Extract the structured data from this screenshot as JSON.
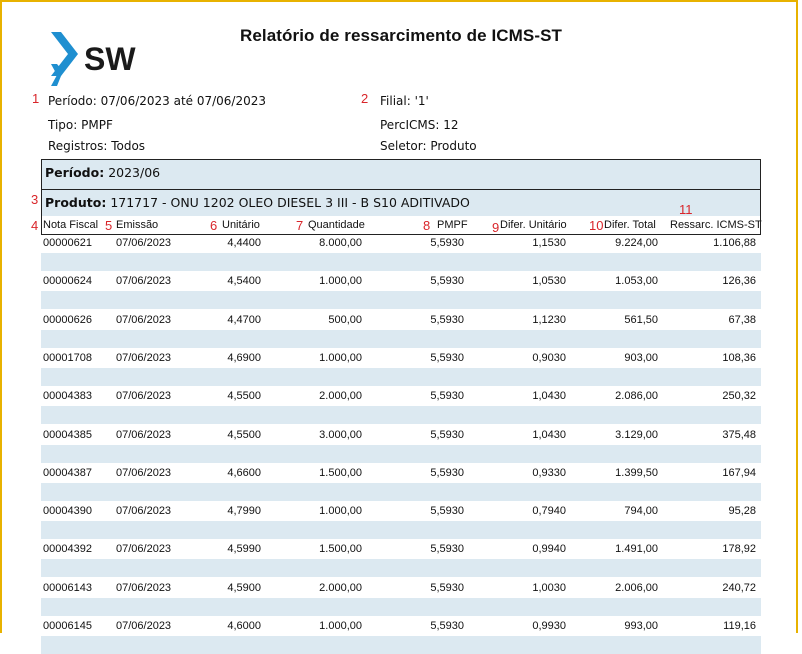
{
  "report": {
    "title": "Relatório de ressarcimento de ICMS-ST",
    "logo_text": "SW",
    "accent_color": "#1f8fd0"
  },
  "meta": {
    "periodo": "Período:  07/06/2023 até 07/06/2023",
    "tipo": "Tipo: PMPF",
    "registros": "Registros: Todos",
    "filial": "Filial: '1'",
    "percicms": "PercICMS: 12",
    "seletor": "Seletor: Produto"
  },
  "annotations": [
    "1",
    "2",
    "3",
    "4",
    "5",
    "6",
    "7",
    "8",
    "9",
    "10",
    "11"
  ],
  "group": {
    "periodo_label": "Período:",
    "periodo_value": "2023/06",
    "produto_label": "Produto:",
    "produto_value": "171717 - ONU 1202 OLEO DIESEL 3 III - B S10 ADITIVADO"
  },
  "columns": [
    "Nota Fiscal",
    "Emissão",
    "Unitário",
    "Quantidade",
    "PMPF",
    "Difer. Unitário",
    "Difer. Total",
    "Ressarc. ICMS-ST"
  ],
  "rows": [
    [
      "00000621",
      "07/06/2023",
      "4,4400",
      "8.000,00",
      "5,5930",
      "1,1530",
      "9.224,00",
      "1.106,88"
    ],
    [
      "00000624",
      "07/06/2023",
      "4,5400",
      "1.000,00",
      "5,5930",
      "1,0530",
      "1.053,00",
      "126,36"
    ],
    [
      "00000626",
      "07/06/2023",
      "4,4700",
      "500,00",
      "5,5930",
      "1,1230",
      "561,50",
      "67,38"
    ],
    [
      "00001708",
      "07/06/2023",
      "4,6900",
      "1.000,00",
      "5,5930",
      "0,9030",
      "903,00",
      "108,36"
    ],
    [
      "00004383",
      "07/06/2023",
      "4,5500",
      "2.000,00",
      "5,5930",
      "1,0430",
      "2.086,00",
      "250,32"
    ],
    [
      "00004385",
      "07/06/2023",
      "4,5500",
      "3.000,00",
      "5,5930",
      "1,0430",
      "3.129,00",
      "375,48"
    ],
    [
      "00004387",
      "07/06/2023",
      "4,6600",
      "1.500,00",
      "5,5930",
      "0,9330",
      "1.399,50",
      "167,94"
    ],
    [
      "00004390",
      "07/06/2023",
      "4,7990",
      "1.000,00",
      "5,5930",
      "0,7940",
      "794,00",
      "95,28"
    ],
    [
      "00004392",
      "07/06/2023",
      "4,5990",
      "1.500,00",
      "5,5930",
      "0,9940",
      "1.491,00",
      "178,92"
    ],
    [
      "00006143",
      "07/06/2023",
      "4,5900",
      "2.000,00",
      "5,5930",
      "1,0030",
      "2.006,00",
      "240,72"
    ],
    [
      "00006145",
      "07/06/2023",
      "4,6000",
      "1.000,00",
      "5,5930",
      "0,9930",
      "993,00",
      "119,16"
    ]
  ]
}
